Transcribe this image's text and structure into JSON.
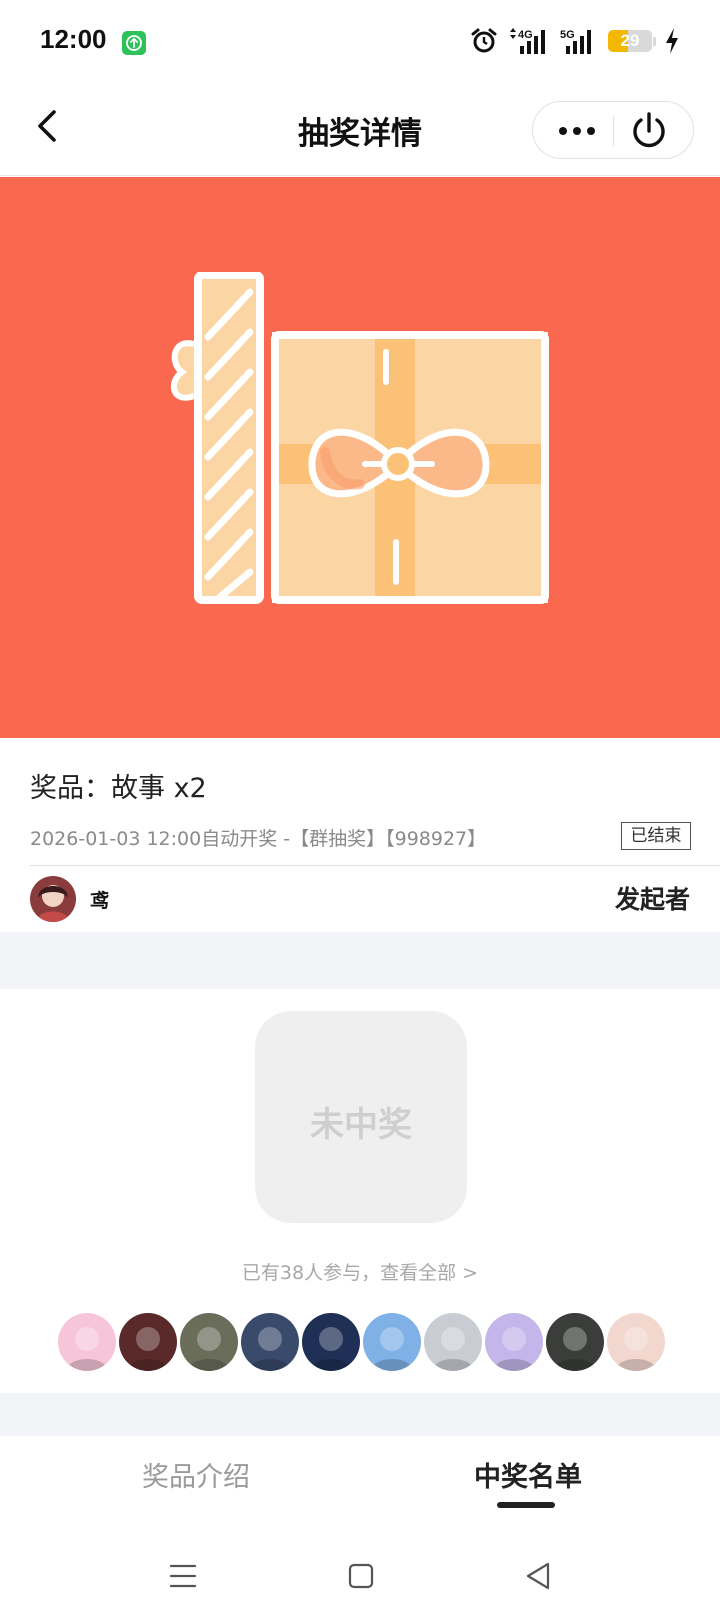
{
  "status_bar": {
    "time": "12:00",
    "network_4g": "4G",
    "network_5g": "5G",
    "battery_level": "29",
    "battery_fraction": 0.29,
    "app_icon": "upload-arrow-icon",
    "accent_green": "#2fc25b",
    "battery_color": "#f5b800"
  },
  "nav": {
    "title": "抽奖详情",
    "back_icon": "chevron-left-icon",
    "more_icon": "more-dots-icon",
    "close_icon": "power-icon"
  },
  "banner": {
    "background": "#f9684f",
    "illustration": "gift-box-icon"
  },
  "prize": {
    "name": "奖品：故事 x2",
    "meta": "2026-01-03 12:00自动开奖 -【群抽奖】【998927】",
    "status_tag": "已结束"
  },
  "host": {
    "name": "鸢",
    "role": "发起者"
  },
  "result": {
    "label": "未中奖"
  },
  "participants": {
    "link_text": "已有38人参与，查看全部 >",
    "avatars": [
      {
        "name": "participant-avatar-1",
        "color": "#f6c6d8"
      },
      {
        "name": "participant-avatar-2",
        "color": "#5a2a2a"
      },
      {
        "name": "participant-avatar-3",
        "color": "#6b6d5b"
      },
      {
        "name": "participant-avatar-4",
        "color": "#3a4a6b"
      },
      {
        "name": "participant-avatar-5",
        "color": "#1f2f55"
      },
      {
        "name": "participant-avatar-6",
        "color": "#7fb0e6"
      },
      {
        "name": "participant-avatar-7",
        "color": "#c9cdd3"
      },
      {
        "name": "participant-avatar-8",
        "color": "#c4b6ea"
      },
      {
        "name": "participant-avatar-9",
        "color": "#3b3d3a"
      },
      {
        "name": "participant-avatar-10",
        "color": "#f2d7cf"
      }
    ]
  },
  "tabs": {
    "intro": "奖品介绍",
    "winners": "中奖名单",
    "active": "winners"
  },
  "system_nav": {
    "menu_icon": "menu-lines-icon",
    "home_icon": "square-home-icon",
    "back_icon": "triangle-back-icon"
  }
}
